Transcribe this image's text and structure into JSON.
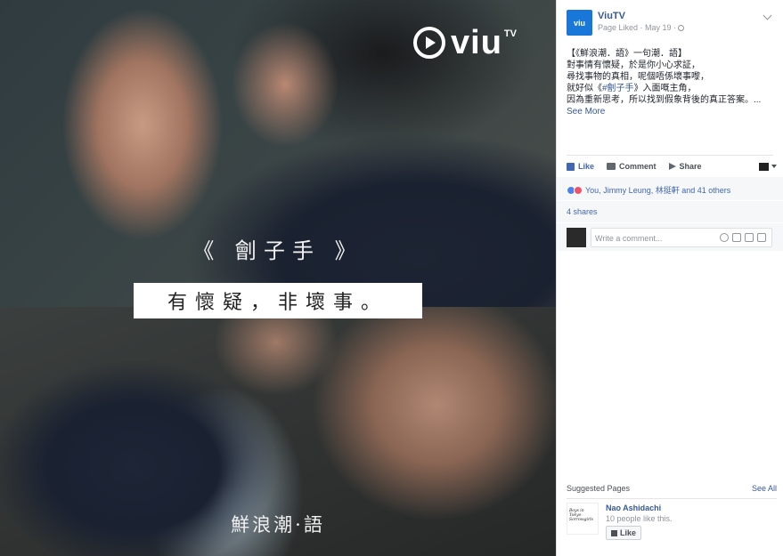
{
  "photo": {
    "logo_text": "viu",
    "logo_tv": "TV",
    "caption_top": "《 劊子手 》",
    "banner_text": "有懷疑，非壞事。",
    "caption_bottom": "鮮浪潮·語"
  },
  "post": {
    "page_name": "ViuTV",
    "avatar_text": "viu",
    "subtitle": "Page Liked · May 19 ·",
    "lines": [
      "【《鮮浪潮．語》一句潮．語】",
      "對事情有懷疑，於是你小心求証，",
      "尋找事物的真相，呢個唔係壞事嚟，"
    ],
    "line4_prefix": "就好似《",
    "line4_link": "#劊子手",
    "line4_suffix": "》入面嘅主角，",
    "line5": "因為重新思考，所以找到假象背後的真正答案。...",
    "see_more": "See More"
  },
  "actions": {
    "like": "Like",
    "comment": "Comment",
    "share": "Share"
  },
  "reactions": {
    "text": "You, Jimmy Leung, 林挺軒 and 41 others"
  },
  "shares": "4 shares",
  "comment": {
    "placeholder": "Write a comment..."
  },
  "suggested": {
    "title": "Suggested Pages",
    "see_all": "See All",
    "page_name": "Nao Ashidachi",
    "page_count": "10 people like this.",
    "thumb_text": "Boys in Tokyo Sorrowgirls",
    "like_label": "Like"
  },
  "colors": {
    "facebook_blue": "#4267b2",
    "link_blue": "#365899",
    "viu_blue": "#1877d9"
  }
}
